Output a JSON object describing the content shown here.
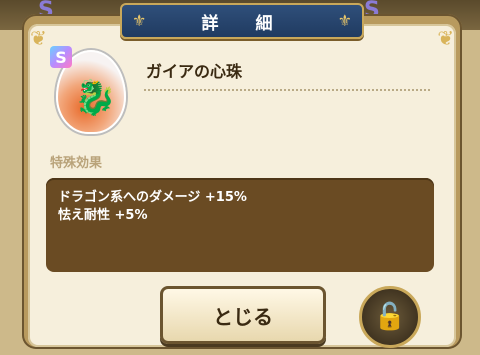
{
  "dialog": {
    "title": "詳　細",
    "item": {
      "rank": "S",
      "name": "ガイアの心珠",
      "icon": "dragon-egg-icon"
    },
    "section_label": "特殊効果",
    "effects": [
      "ドラゴン系へのダメージ +15%",
      "怯え耐性 +5%"
    ],
    "close_label": "とじる",
    "lock_icon": "unlock-icon"
  },
  "background": {
    "badges": [
      "S",
      "S"
    ]
  }
}
